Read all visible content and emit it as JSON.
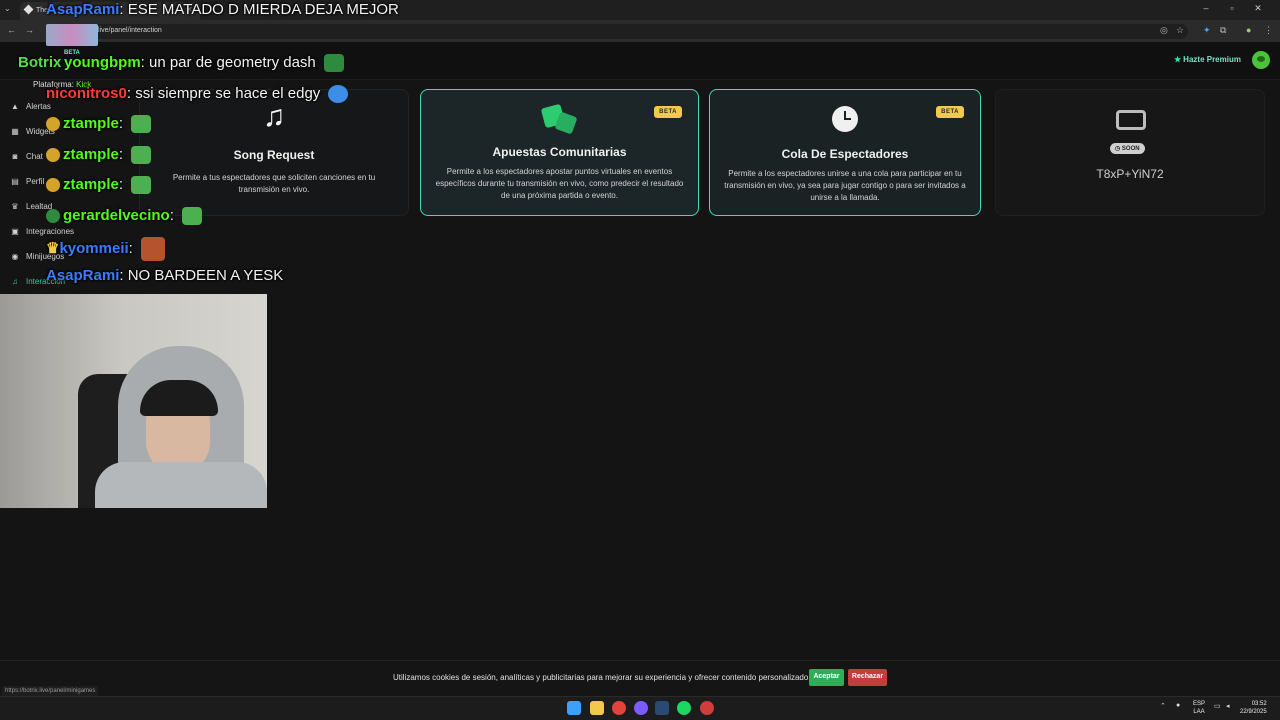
{
  "browser": {
    "tab_title": "The",
    "url": "live/panel/interaction",
    "status_url": "https://botrix.live/panel/minigames"
  },
  "header": {
    "premium_label": "Hazte Premium",
    "brand_badge": "BETA"
  },
  "sidebar": {
    "platform_label": "Plataforma:",
    "platform_value": "Kick",
    "items": [
      {
        "label": "Alertas",
        "icon": "bell-icon"
      },
      {
        "label": "Widgets",
        "icon": "grid-icon"
      },
      {
        "label": "Chat",
        "icon": "robot-icon"
      },
      {
        "label": "Perfil",
        "icon": "id-card-icon"
      },
      {
        "label": "Lealtad",
        "icon": "trophy-icon"
      },
      {
        "label": "Integraciones",
        "icon": "plug-icon"
      },
      {
        "label": "Minijuegos",
        "icon": "gamepad-icon"
      },
      {
        "label": "Interacción",
        "icon": "music-icon",
        "active": true
      }
    ]
  },
  "cards": {
    "song": {
      "title": "Song Request",
      "desc": "Permite a tus espectadores que soliciten canciones en tu transmisión en vivo."
    },
    "bets": {
      "title": "Apuestas Comunitarias",
      "badge": "BETA",
      "desc": "Permite a los espectadores apostar puntos virtuales en eventos específicos durante tu transmisión en vivo, como predecir el resultado de una próxima partida o evento."
    },
    "queue": {
      "title": "Cola De Espectadores",
      "badge": "BETA",
      "desc": "Permite a los espectadores unirse a una cola para participar en tu transmisión en vivo, ya sea para jugar contigo o para ser invitados a unirse a la llamada."
    },
    "soon": {
      "title": "T8xP+YiN72",
      "badge": "SOON"
    }
  },
  "chat": [
    {
      "user": "AsapRami",
      "user_color": "#3d7bff",
      "msg": ": ESE MATADO D MIERDA DEJA MEJOR"
    },
    {
      "user": "Botrix",
      "user_color": "#53e04a",
      "msg": ""
    },
    {
      "user": "youngbpm",
      "user_color": "#53fc18",
      "msg": ": un par de geometry dash"
    },
    {
      "user": "niconitros0",
      "user_color": "#ff3b3b",
      "msg": ": ssi siempre se hace el edgy"
    },
    {
      "user": "ztample",
      "user_color": "#53fc18",
      "msg": ":"
    },
    {
      "user": "ztample",
      "user_color": "#53fc18",
      "msg": ":"
    },
    {
      "user": "ztample",
      "user_color": "#53fc18",
      "msg": ":"
    },
    {
      "user": "gerardelvecino",
      "user_color": "#53fc18",
      "msg": ":"
    },
    {
      "user": "kyommeii",
      "user_color": "#3d7bff",
      "msg": ":"
    },
    {
      "user": "AsapRami",
      "user_color": "#3d7bff",
      "msg": ":  NO BARDEEN A YESK"
    }
  ],
  "cookie": {
    "text": "Utilizamos cookies de sesión, analíticas y publicitarias para mejorar su experiencia y ofrecer contenido personalizado.",
    "accept": "Aceptar",
    "reject": "Rechazar"
  },
  "taskbar": {
    "lang_line1": "ESP",
    "lang_line2": "LAA",
    "time": "03:52",
    "date": "22/9/2025"
  },
  "colors": {
    "accent": "#3fdcb7",
    "beta": "#f2c94c",
    "kick_green": "#53fc18"
  }
}
